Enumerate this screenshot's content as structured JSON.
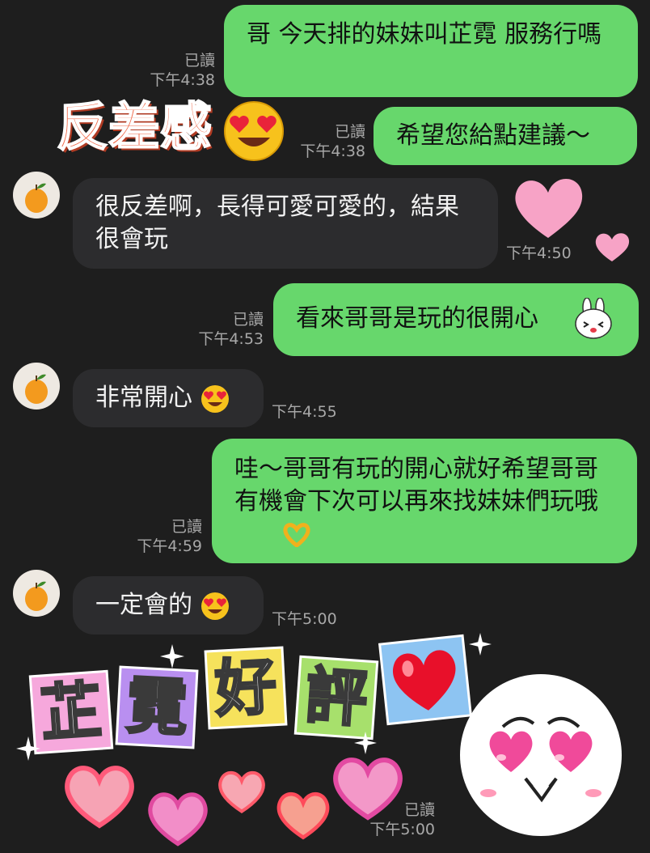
{
  "messages": [
    {
      "id": "m1",
      "text": "哥 今天排的妹妹叫芷霓 服務行嗎",
      "read": "已讀",
      "time": "下午4:38"
    },
    {
      "id": "m2",
      "text": "希望您給點建議～",
      "read": "已讀",
      "time": "下午4:38"
    },
    {
      "id": "m3",
      "text": "很反差啊，長得可愛可愛的，結果很會玩",
      "time": "下午4:50"
    },
    {
      "id": "m4",
      "text": "看來哥哥是玩的很開心",
      "read": "已讀",
      "time": "下午4:53"
    },
    {
      "id": "m5",
      "text": "非常開心",
      "time": "下午4:55"
    },
    {
      "id": "m6",
      "text": "哇～哥哥有玩的開心就好希望哥哥有機會下次可以再來找妹妹們玩哦",
      "read": "已讀",
      "time": "下午4:59"
    },
    {
      "id": "m7",
      "text": "一定會的",
      "time": "下午5:00"
    },
    {
      "id": "m8",
      "read": "已讀",
      "time": "下午5:00"
    }
  ],
  "stickers": {
    "contrast": "反差感",
    "review": [
      "芷",
      "霓",
      "好",
      "評"
    ]
  },
  "colors": {
    "outgoing": "#67d76c",
    "incoming": "#2c2c2e",
    "background": "#1e1e1e"
  },
  "icons": [
    "orange-avatar-icon",
    "heart-eyes-emoji-icon",
    "bunny-sticker-icon",
    "heart-hands-emoji-icon",
    "heart-sticker-icon",
    "heart-eyes-face-sticker-icon"
  ]
}
